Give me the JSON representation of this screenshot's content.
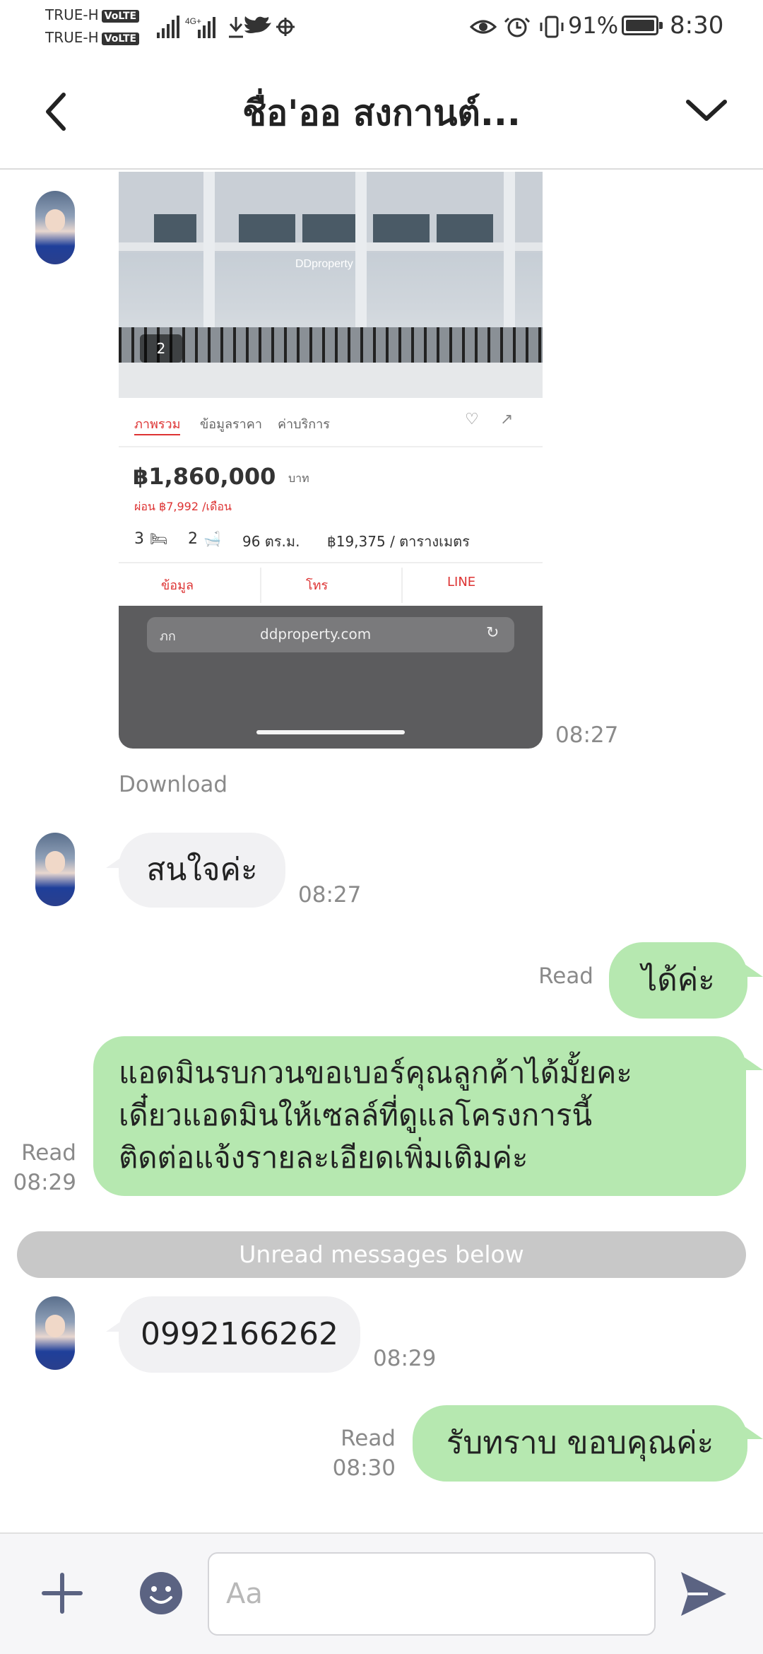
{
  "status_bar": {
    "carrier1": "TRUE-H",
    "carrier2": "TRUE-H",
    "volte": "VoLTE",
    "network": "4G+",
    "battery": "91%",
    "time": "8:30"
  },
  "header": {
    "title": "ชื่อ'ออ สงกานต์..."
  },
  "listing_screenshot": {
    "watermark": "DDproperty",
    "image_count": "2",
    "tabs": [
      "ภาพรวม",
      "ข้อมูลราคา",
      "ค่าบริการ"
    ],
    "price": "฿1,860,000",
    "price_unit": "บาท",
    "installment": "ผ่อน ฿7,992 /เดือน",
    "beds": "3",
    "baths": "2",
    "area": "96 ตร.ม.",
    "price_per_sqm": "฿19,375 / ตารางเมตร",
    "actions": [
      "ข้อมูล",
      "โทร",
      "LINE"
    ],
    "browser_left": "ภก",
    "url": "ddproperty.com"
  },
  "messages": {
    "image_time": "08:27",
    "download": "Download",
    "msg1_text": "สนใจค่ะ",
    "msg1_time": "08:27",
    "msg2_read": "Read",
    "msg2_text": "ได้ค่ะ",
    "msg3_read": "Read",
    "msg3_time": "08:29",
    "msg3_lines": [
      "แอดมินรบกวนขอเบอร์คุณลูกค้าได้มั้ยคะ",
      "เดี๋ยวแอดมินให้เซลล์ที่ดูแลโครงการนี้",
      "ติดต่อแจ้งรายละเอียดเพิ่มเติมค่ะ"
    ],
    "unread_banner": "Unread messages below",
    "msg4_text": "0992166262",
    "msg4_time": "08:29",
    "msg5_read": "Read",
    "msg5_time": "08:30",
    "msg5_text": "รับทราบ ขอบคุณค่ะ"
  },
  "input_bar": {
    "placeholder": "Aa"
  },
  "colors": {
    "outgoing_bubble": "#b6e8b0",
    "incoming_bubble": "#f1f1f3",
    "unread_banner": "#c8c8c8",
    "accent_icons": "#5b6382"
  }
}
